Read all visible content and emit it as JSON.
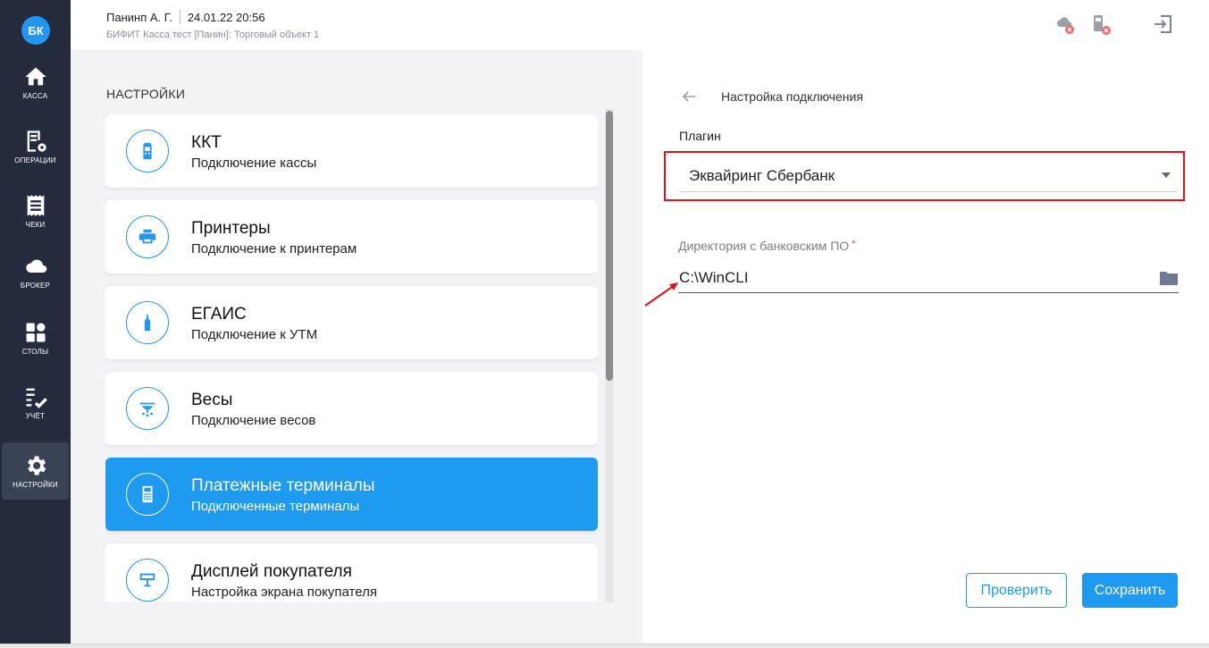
{
  "sidebar": {
    "logo": "БК",
    "items": [
      {
        "label": "КАССА",
        "icon": "home-icon"
      },
      {
        "label": "ОПЕРАЦИИ",
        "icon": "operations-icon"
      },
      {
        "label": "ЧЕКИ",
        "icon": "receipt-icon"
      },
      {
        "label": "БРОКЕР",
        "icon": "cloud-icon"
      },
      {
        "label": "СТОЛЫ",
        "icon": "tables-icon"
      },
      {
        "label": "УЧЁТ",
        "icon": "checklist-icon"
      },
      {
        "label": "НАСТРОЙКИ",
        "icon": "gear-icon",
        "active": true
      }
    ]
  },
  "header": {
    "user": "Панинп А. Г.",
    "datetime": "24.01.22 20:56",
    "subtitle": "БИФИТ Касса тест [Панин]: Торговый объект 1"
  },
  "settings": {
    "title": "НАСТРОЙКИ",
    "cards": [
      {
        "title": "ККТ",
        "subtitle": "Подключение кассы",
        "icon": "kkt-icon"
      },
      {
        "title": "Принтеры",
        "subtitle": "Подключение к принтерам",
        "icon": "printer-icon"
      },
      {
        "title": "ЕГАИС",
        "subtitle": "Подключение к УТМ",
        "icon": "bottle-icon"
      },
      {
        "title": "Весы",
        "subtitle": "Подключение весов",
        "icon": "scales-icon"
      },
      {
        "title": "Платежные терминалы",
        "subtitle": "Подключенные терминалы",
        "icon": "terminal-icon",
        "active": true
      },
      {
        "title": "Дисплей покупателя",
        "subtitle": "Настройка экрана покупателя",
        "icon": "display-icon"
      }
    ]
  },
  "connection": {
    "title": "Настройка подключения",
    "plugin_label": "Плагин",
    "plugin_value": "Эквайринг Сбербанк",
    "dir_label": "Директория с банковским ПО",
    "dir_required_mark": "*",
    "dir_value": "C:\\WinCLI",
    "check_button": "Проверить",
    "save_button": "Сохранить"
  },
  "colors": {
    "accent": "#1e9bf0",
    "sidebar_bg": "#232b3d",
    "highlight_red": "#e0131c"
  }
}
